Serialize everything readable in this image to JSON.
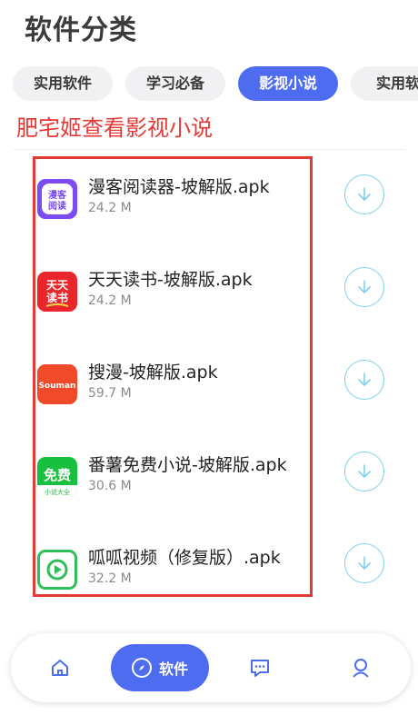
{
  "header": {
    "title": "软件分类"
  },
  "tabs": [
    {
      "label": "实用软件",
      "active": false
    },
    {
      "label": "学习必备",
      "active": false
    },
    {
      "label": "影视小说",
      "active": true
    },
    {
      "label": "实用软",
      "active": false
    }
  ],
  "annotation": "肥宅姬查看影视小说",
  "apps": [
    {
      "name": "漫客阅读器-坡解版.apk",
      "size": "24.2 M",
      "icon": "manke-reader-icon",
      "icon_color": "#7b4cf2",
      "icon_text_1": "漫客",
      "icon_text_2": "阅读"
    },
    {
      "name": "天天读书-坡解版.apk",
      "size": "24.2 M",
      "icon": "tiantian-dushu-icon",
      "icon_color": "#e8262b",
      "icon_text_1": "天天",
      "icon_text_2": "读书"
    },
    {
      "name": "搜漫-坡解版.apk",
      "size": "59.7 M",
      "icon": "souman-icon",
      "icon_color": "#f04a2b",
      "icon_text_1": "Souman"
    },
    {
      "name": "番薯免费小说-坡解版.apk",
      "size": "30.6 M",
      "icon": "fanshu-novel-icon",
      "icon_color": "#19c040",
      "icon_text_1": "免费",
      "icon_text_2": "小说大全"
    },
    {
      "name": "呱呱视频（修复版）.apk",
      "size": "32.2 M",
      "icon": "guagua-video-icon",
      "icon_color": "#2fbe5a"
    }
  ],
  "colors": {
    "accent": "#4d6cf0",
    "annotation_red": "#e53935",
    "download_cyan": "#7fd0ee"
  },
  "bottom_nav": {
    "active_label": "软件"
  }
}
